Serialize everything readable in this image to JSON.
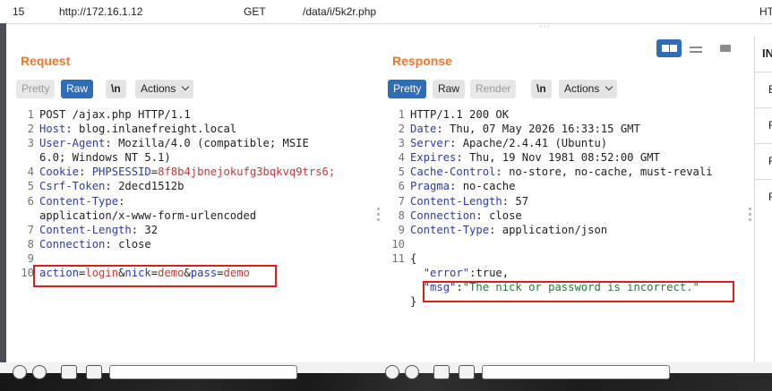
{
  "history_row": {
    "id": "15",
    "host": "http://172.16.1.12",
    "method": "GET",
    "path": "/data/i/5k2r.php",
    "status_partial": "HT"
  },
  "request": {
    "title": "Request",
    "buttons": {
      "pretty": "Pretty",
      "raw": "Raw",
      "newline": "\\n",
      "actions": "Actions"
    },
    "lines": [
      {
        "n": "1",
        "text": "POST /ajax.php HTTP/1.1"
      },
      {
        "n": "2",
        "key": "Host",
        "val": "blog.inlanefreight.local"
      },
      {
        "n": "3",
        "key": "User-Agent",
        "val": "Mozilla/4.0 (compatible; MSIE"
      },
      {
        "n": "",
        "text": "6.0; Windows NT 5.1)"
      },
      {
        "n": "4",
        "key": "Cookie",
        "cookie_name": "PHPSESSID",
        "cookie_val": "8f8b4jbnejokufg3bqkvq9trs6;"
      },
      {
        "n": "5",
        "key": "Csrf-Token",
        "val": "2decd1512b"
      },
      {
        "n": "6",
        "key": "Content-Type",
        "val": ""
      },
      {
        "n": "",
        "text": "application/x-www-form-urlencoded"
      },
      {
        "n": "7",
        "key": "Content-Length",
        "val": "32"
      },
      {
        "n": "8",
        "key": "Connection",
        "val": "close"
      },
      {
        "n": "9",
        "text": ""
      },
      {
        "n": "10",
        "body": [
          {
            "k": "action",
            "v": "login"
          },
          {
            "k": "nick",
            "v": "demo"
          },
          {
            "k": "pass",
            "v": "demo"
          }
        ]
      }
    ]
  },
  "response": {
    "title": "Response",
    "buttons": {
      "pretty": "Pretty",
      "raw": "Raw",
      "render": "Render",
      "newline": "\\n",
      "actions": "Actions"
    },
    "lines": [
      {
        "n": "1",
        "text": "HTTP/1.1 200 OK"
      },
      {
        "n": "2",
        "key": "Date",
        "val": "Thu, 07 May 2026 16:33:15 GMT"
      },
      {
        "n": "3",
        "key": "Server",
        "val": "Apache/2.4.41 (Ubuntu)"
      },
      {
        "n": "4",
        "key": "Expires",
        "val": "Thu, 19 Nov 1981 08:52:00 GMT"
      },
      {
        "n": "5",
        "key": "Cache-Control",
        "val": "no-store, no-cache, must-revali"
      },
      {
        "n": "6",
        "key": "Pragma",
        "val": "no-cache"
      },
      {
        "n": "7",
        "key": "Content-Length",
        "val": "57"
      },
      {
        "n": "8",
        "key": "Connection",
        "val": "close"
      },
      {
        "n": "9",
        "key": "Content-Type",
        "val": "application/json"
      },
      {
        "n": "10",
        "text": ""
      },
      {
        "n": "11",
        "text": "{"
      },
      {
        "n": "",
        "json_key": "\"error\"",
        "json_val": "true,"
      },
      {
        "n": "",
        "json_key": "\"msg\"",
        "json_str": "\"The nick or password is incorrect.\""
      },
      {
        "n": "",
        "text": "}"
      }
    ]
  },
  "inspector": {
    "header_partial": "IN",
    "rows": [
      "B",
      "R",
      "R",
      "R"
    ]
  }
}
